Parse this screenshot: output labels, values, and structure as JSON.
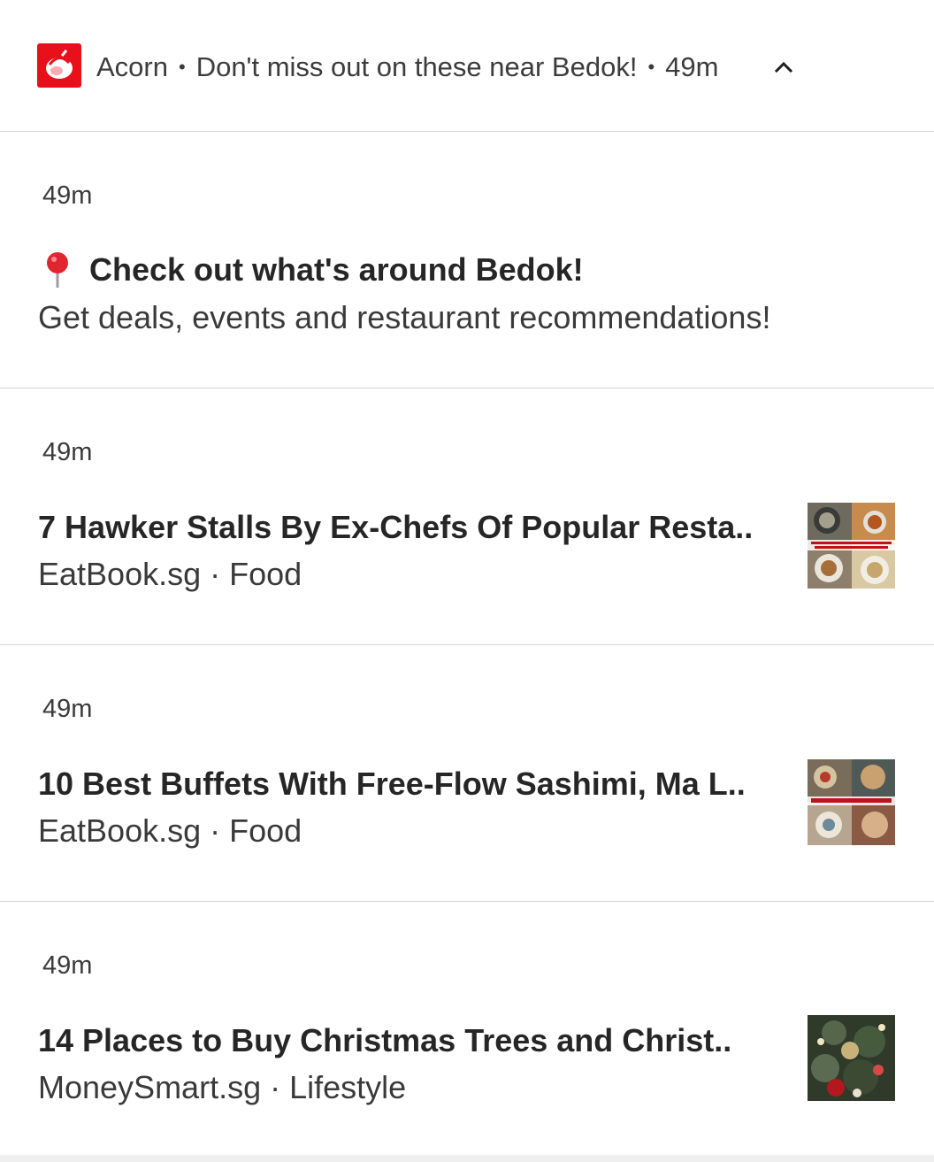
{
  "header": {
    "app_name": "Acorn",
    "separator": "•",
    "summary": "Don't miss out on these near Bedok!",
    "time": "49m",
    "app_icon": "acorn-logo",
    "expand_icon": "chevron-up-icon",
    "brand_color": "#e8101a"
  },
  "notifications": [
    {
      "time": "49m",
      "icon": "round-pushpin-icon",
      "title": "Check out what's around Bedok!",
      "subtitle": "Get deals, events and restaurant recommendations!"
    },
    {
      "time": "49m",
      "title": "7 Hawker Stalls By Ex-Chefs Of Popular Resta..",
      "source": "EatBook.sg",
      "category": "Food",
      "meta": "EatBook.sg · Food",
      "thumbnail": "food-collage-thumbnail"
    },
    {
      "time": "49m",
      "title": "10 Best Buffets With Free-Flow Sashimi, Ma L..",
      "source": "EatBook.sg",
      "category": "Food",
      "meta": "EatBook.sg · Food",
      "thumbnail": "buffet-collage-thumbnail"
    },
    {
      "time": "49m",
      "title": "14 Places to Buy Christmas Trees and Christ..",
      "source": "MoneySmart.sg",
      "category": "Lifestyle",
      "meta": "MoneySmart.sg · Lifestyle",
      "thumbnail": "christmas-tree-thumbnail"
    }
  ]
}
